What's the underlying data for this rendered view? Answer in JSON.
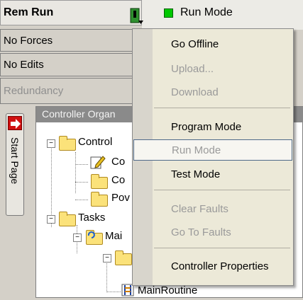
{
  "status": {
    "mode": "Rem Run",
    "forces": "No Forces",
    "edits": "No Edits",
    "redundancy": "Redundancy"
  },
  "header": {
    "run_mode_label": "Run Mode",
    "run_indicator_color": "#00c800",
    "key_icon": "keyswitch-icon"
  },
  "side_tab": {
    "label": "Start Page",
    "icon": "arrow-right-icon"
  },
  "organizer": {
    "title": "Controller Organ",
    "tree": {
      "controller": "Control",
      "child1": "Co",
      "child2": "Co",
      "child3": "Pov",
      "tasks": "Tasks",
      "main_task": "Mai",
      "main_routine": "MainRoutine"
    }
  },
  "menu": {
    "items": [
      {
        "label": "Go Offline",
        "enabled": true
      },
      {
        "label": "Upload...",
        "enabled": false
      },
      {
        "label": "Download",
        "enabled": false
      },
      {
        "label": "Program Mode",
        "enabled": true
      },
      {
        "label": "Run Mode",
        "enabled": false,
        "highlighted": true
      },
      {
        "label": "Test Mode",
        "enabled": true
      },
      {
        "label": "Clear Faults",
        "enabled": false
      },
      {
        "label": "Go To Faults",
        "enabled": false
      },
      {
        "label": "Controller Properties",
        "enabled": true
      }
    ]
  }
}
